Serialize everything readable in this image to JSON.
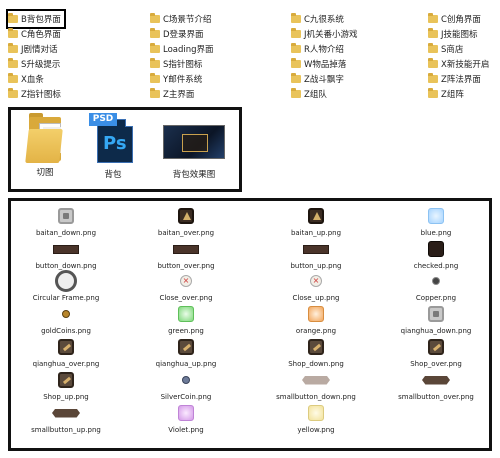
{
  "folders": [
    {
      "label": "B背包界面",
      "selected": true
    },
    {
      "label": "C场景节介绍"
    },
    {
      "label": "C九很系统"
    },
    {
      "label": "C创角界面"
    },
    {
      "label": "C角色界面"
    },
    {
      "label": "D登录界面"
    },
    {
      "label": "J机关番小游戏"
    },
    {
      "label": "J技能图标"
    },
    {
      "label": "J剧情对话"
    },
    {
      "label": "Loading界面"
    },
    {
      "label": "R人物介绍"
    },
    {
      "label": "S商店"
    },
    {
      "label": "S升级提示"
    },
    {
      "label": "S指针图标"
    },
    {
      "label": "W物品掉落"
    },
    {
      "label": "X新技能开启"
    },
    {
      "label": "X血条"
    },
    {
      "label": "Y邮件系统"
    },
    {
      "label": "Z战斗飘字"
    },
    {
      "label": "Z阵法界面"
    },
    {
      "label": "Z指针图标"
    },
    {
      "label": "Z主界面"
    },
    {
      "label": "Z组队"
    },
    {
      "label": "Z组阵"
    }
  ],
  "psd_files": [
    {
      "label": "切图",
      "icon": "folder-icon"
    },
    {
      "label": "背包",
      "icon": "psd-file-icon",
      "badge": "PSD",
      "glyph": "Ps"
    },
    {
      "label": "背包效果图",
      "icon": "image-thumbnail"
    }
  ],
  "png_files": [
    {
      "name": "baitan_down.png",
      "icon": "gray-button"
    },
    {
      "name": "baitan_over.png",
      "icon": "triangle-button"
    },
    {
      "name": "baitan_up.png",
      "icon": "triangle-button"
    },
    {
      "name": "blue.png",
      "icon": "blue-slot"
    },
    {
      "name": "button_down.png",
      "icon": "bar"
    },
    {
      "name": "button_over.png",
      "icon": "bar"
    },
    {
      "name": "button_up.png",
      "icon": "bar"
    },
    {
      "name": "checked.png",
      "icon": "checked-slot"
    },
    {
      "name": "Circular Frame.png",
      "icon": "circle-frame"
    },
    {
      "name": "Close_over.png",
      "icon": "close-x"
    },
    {
      "name": "Close_up.png",
      "icon": "close-x"
    },
    {
      "name": "Copper.png",
      "icon": "coin"
    },
    {
      "name": "goldCoins.png",
      "icon": "gold-coin"
    },
    {
      "name": "green.png",
      "icon": "green-slot"
    },
    {
      "name": "orange.png",
      "icon": "orange-slot"
    },
    {
      "name": "qianghua_down.png",
      "icon": "gray-button"
    },
    {
      "name": "qianghua_over.png",
      "icon": "hammer-button"
    },
    {
      "name": "qianghua_up.png",
      "icon": "hammer-button"
    },
    {
      "name": "Shop_down.png",
      "icon": "hammer-button"
    },
    {
      "name": "Shop_over.png",
      "icon": "hammer-button"
    },
    {
      "name": "Shop_up.png",
      "icon": "hammer-button"
    },
    {
      "name": "SilverCoin.png",
      "icon": "silver-coin"
    },
    {
      "name": "smallbutton_down.png",
      "icon": "hex-light"
    },
    {
      "name": "smallbutton_over.png",
      "icon": "hex"
    },
    {
      "name": "smallbutton_up.png",
      "icon": "hex"
    },
    {
      "name": "Violet.png",
      "icon": "violet-slot"
    },
    {
      "name": "yellow.png",
      "icon": "yellow-slot"
    }
  ]
}
